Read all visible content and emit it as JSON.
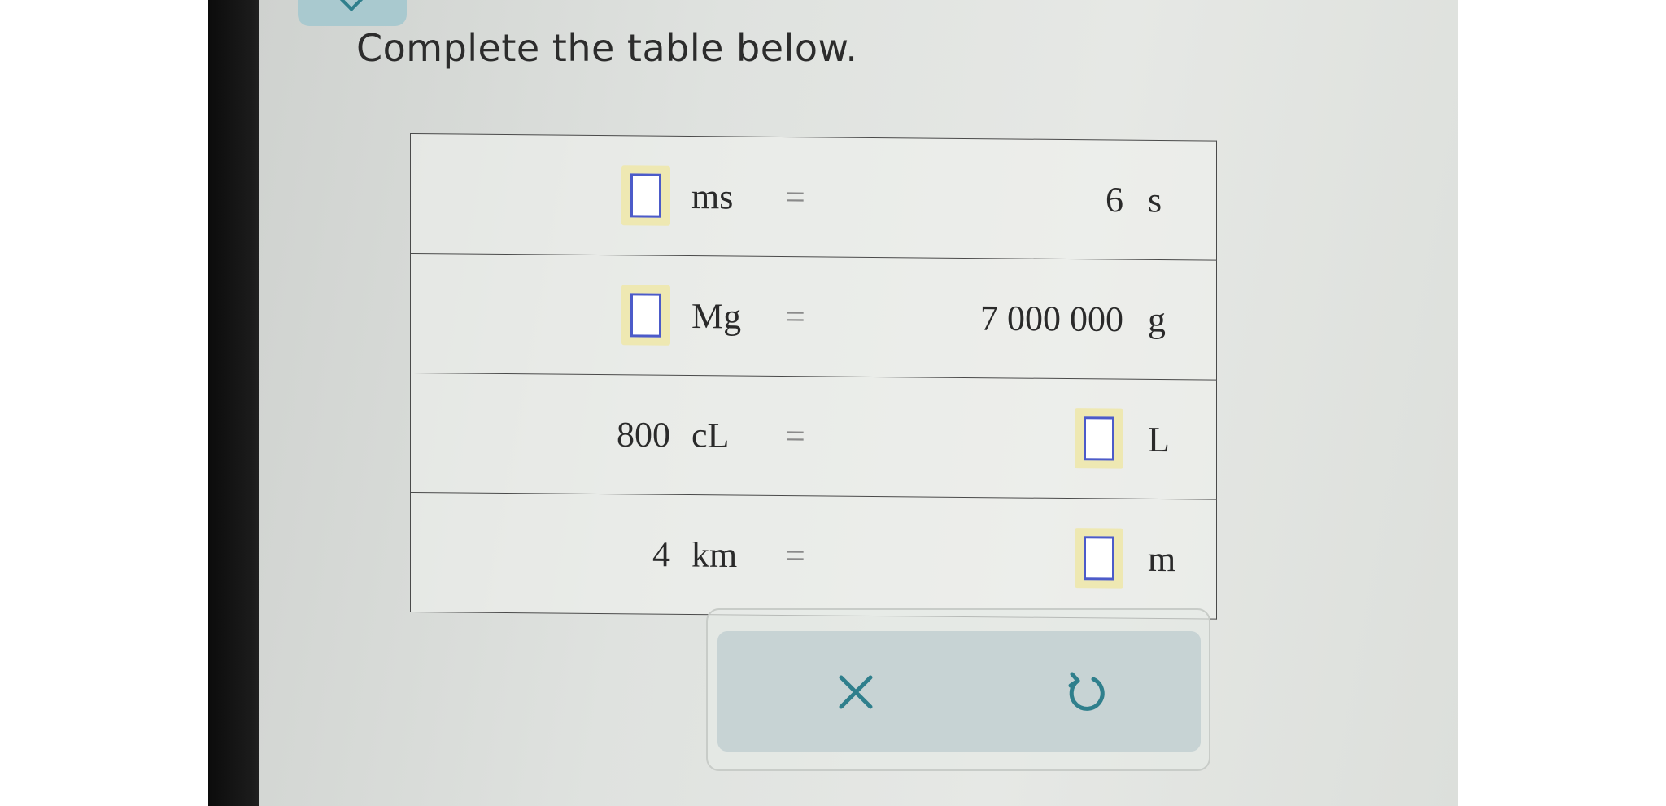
{
  "instruction": "Complete the table below.",
  "table": {
    "equals_sign": "=",
    "rows": [
      {
        "left_value": "",
        "left_unit": "ms",
        "right_value": "6",
        "right_unit": "s"
      },
      {
        "left_value": "",
        "left_unit": "Mg",
        "right_value": "7 000 000",
        "right_unit": "g"
      },
      {
        "left_value": "800",
        "left_unit": "cL",
        "right_value": "",
        "right_unit": "L"
      },
      {
        "left_value": "4",
        "left_unit": "km",
        "right_value": "",
        "right_unit": "m"
      }
    ]
  },
  "actions": {
    "clear_icon": "x-icon",
    "undo_icon": "undo-icon"
  },
  "colors": {
    "input_highlight": "#eee8b2",
    "input_border": "#4c5bc9",
    "action_bar": "#c7d3d4",
    "icon": "#2f7f8c"
  }
}
